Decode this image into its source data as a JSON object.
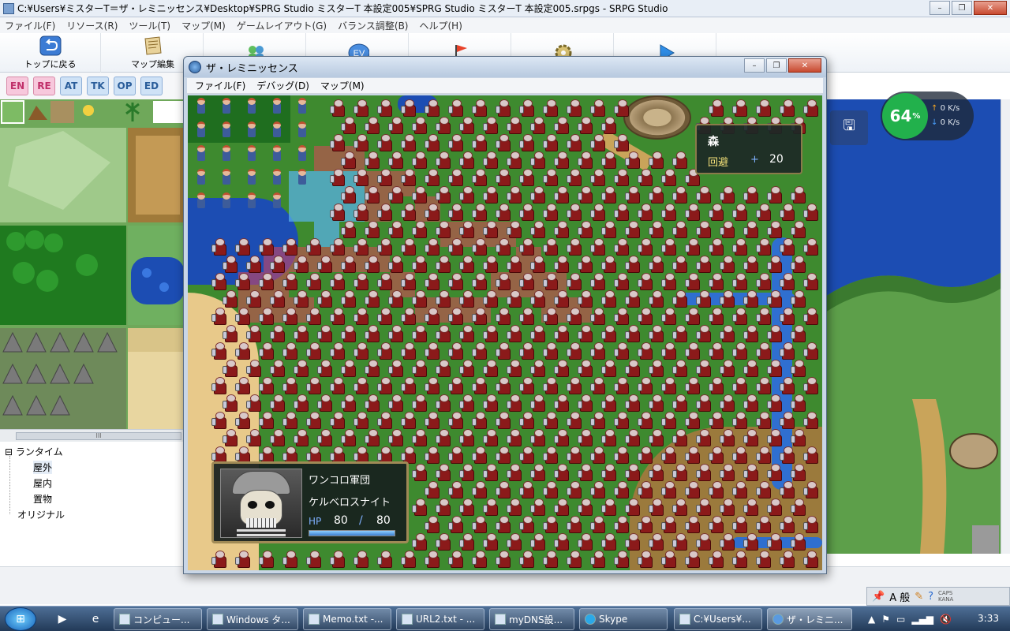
{
  "main_window": {
    "title": "C:¥Users¥ミスターT＝ザ・レミニッセンス¥Desktop¥SPRG Studio ミスターT 本設定005¥SPRG Studio ミスターT 本設定005.srpgs - SRPG Studio",
    "menu": [
      "ファイル(F)",
      "リソース(R)",
      "ツール(T)",
      "マップ(M)",
      "ゲームレイアウト(G)",
      "バランス調整(B)",
      "ヘルプ(H)"
    ],
    "toolbar": [
      {
        "label": "トップに戻る",
        "icon": "return-arrow-icon"
      },
      {
        "label": "マップ編集",
        "icon": "map-scroll-icon"
      },
      {
        "label": "",
        "icon": "units-icon"
      },
      {
        "label": "",
        "icon": "event-icon"
      },
      {
        "label": "",
        "icon": "flag-icon"
      },
      {
        "label": "",
        "icon": "gear-icon"
      },
      {
        "label": "",
        "icon": "play-icon"
      }
    ],
    "event_badge": "EV",
    "tag_buttons": [
      "EN",
      "RE",
      "AT",
      "TK",
      "OP",
      "ED"
    ],
    "tree": {
      "root": "ランタイム",
      "children": [
        "屋外",
        "屋内",
        "置物"
      ],
      "other": "オリジナル"
    },
    "scroll_grip": "III"
  },
  "network_widget": {
    "percent": "64",
    "percent_unit": "%",
    "up": "0 K/s",
    "down": "0 K/s"
  },
  "ime": {
    "mode": "A 般",
    "caps": "CAPS",
    "kana": "KANA"
  },
  "game_window": {
    "title": "ザ・レミニッセンス",
    "menu": [
      "ファイル(F)",
      "デバッグ(D)",
      "マップ(M)"
    ],
    "terrain": {
      "name": "森",
      "stat": "回避",
      "plus": "+",
      "value": "20"
    },
    "unit": {
      "group": "ワンコロ軍団",
      "name": "ケルベロスナイト",
      "hp_label": "HP",
      "hp_current": "80",
      "hp_separator": "/",
      "hp_max": "80",
      "hp_fraction": 1.0
    }
  },
  "taskbar": {
    "items": [
      "コンピュー...",
      "Windows タ...",
      "Memo.txt -...",
      "URL2.txt - ...",
      "myDNS設...",
      "Skype",
      "C:¥Users¥...",
      "ザ・レミニ..."
    ],
    "clock": "3:33"
  },
  "colors": {
    "enemy_red": "#8b1a1a",
    "move_blue": "#5ab4f0",
    "move_red": "#dc465a",
    "water": "#1c4db3",
    "grass": "#3e8a2f",
    "network_green": "#22b14c"
  }
}
